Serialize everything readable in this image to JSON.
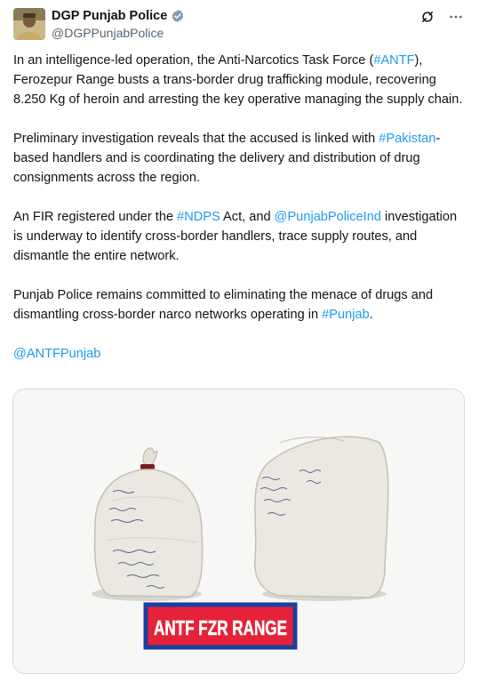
{
  "author": {
    "display_name": "DGP Punjab Police",
    "handle": "@DGPPunjabPolice",
    "verified_icon": "verified-badge-icon"
  },
  "actions": {
    "grok_icon": "grok-icon",
    "more_icon": "more-icon"
  },
  "post": {
    "p1": {
      "a": "In an intelligence-led operation, the Anti-Narcotics Task Force (",
      "tag": "#ANTF",
      "b": "), Ferozepur Range busts a trans-border drug trafficking module, recovering 8.250 Kg of heroin and arresting the key operative managing the supply chain."
    },
    "p2": {
      "a": "Preliminary investigation reveals that the accused is linked with ",
      "tag": "#Pakistan",
      "b": "-based handlers and is coordinating the delivery and distribution of drug consignments across the region."
    },
    "p3": {
      "a": "An FIR registered under the ",
      "tag": "#NDPS",
      "b": " Act, and ",
      "mention": "@PunjabPoliceInd",
      "c": " investigation is underway to identify cross-border handlers, trace supply routes, and dismantle the entire network."
    },
    "p4": {
      "a": "Punjab Police remains committed to eliminating the menace of drugs and dismantling cross-border narco networks operating in ",
      "tag": "#Punjab",
      "b": "."
    },
    "p5": {
      "mention": "@ANTFPunjab"
    }
  },
  "media": {
    "banner_text": "ANTF FZR RANGE"
  },
  "colors": {
    "link": "#1d9bf0",
    "text": "#0f1419",
    "muted": "#536471",
    "banner_bg": "#e5223a",
    "banner_border": "#1b3f9e",
    "verified": "#829aab"
  }
}
